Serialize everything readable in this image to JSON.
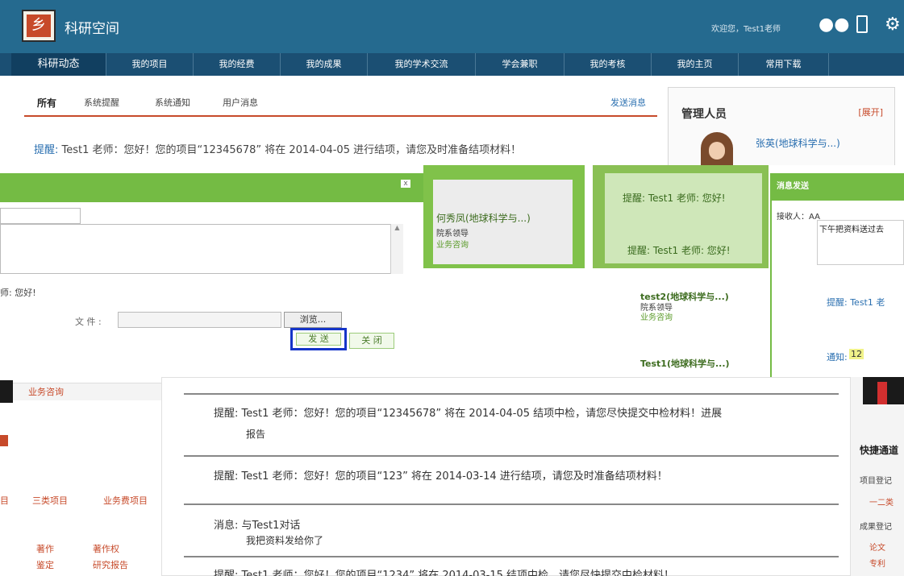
{
  "app": {
    "logo_text": "乡",
    "title": "科研空间",
    "welcome": "欢迎您，Test1老师"
  },
  "nav": [
    "科研动态",
    "我的项目",
    "我的经费",
    "我的成果",
    "我的学术交流",
    "学会兼职",
    "我的考核",
    "我的主页",
    "常用下载"
  ],
  "tabs": {
    "items": [
      "所有",
      "系统提醒",
      "系统通知",
      "用户消息"
    ],
    "send_link": "发送消息"
  },
  "reminder": {
    "tag": "提醒:",
    "text": " Test1 老师：您好！您的项目“12345678” 将在 2014-04-05 进行结项，请您及时准备结项材料！"
  },
  "admin_panel": {
    "title": "管理人员",
    "expand": "[展开]",
    "name": "张英(地球科学与...)"
  },
  "modal": {
    "close": "x",
    "file_label": "文 件 :",
    "browse": "浏览...",
    "send": "发 送",
    "close_btn": "关 闭",
    "reminder_tail": "师: 您好!"
  },
  "contacts": [
    {
      "name": "何秀凤(地球科学与...)",
      "role": "院系领导",
      "action": "业务咨询"
    }
  ],
  "bg_reminders": [
    "提醒: Test1 老师: 您好!",
    "提醒: Test1 老师: 您好!"
  ],
  "message_send": {
    "title": "消息发送",
    "recipient_label": "接收人：AA",
    "content": "下午把资料送过去"
  },
  "students": [
    {
      "name": "test2(地球科学与...)",
      "role": "院系领导",
      "action": "业务咨询"
    },
    {
      "name": "Test1(地球科学与...)"
    }
  ],
  "right_reminder": "提醒: Test1 老",
  "right_notice": "通知:",
  "right_count": "12",
  "left_panel": {
    "biz": "业务咨询",
    "sub_nav": [
      "目",
      "三类项目",
      "业务费项目"
    ],
    "works": [
      "著作",
      "著作权",
      "鉴定",
      "研究报告"
    ]
  },
  "messages": [
    {
      "text": "提醒: Test1 老师：您好！您的项目“12345678” 将在 2014-04-05 结项中检，请您尽快提交中检材料！进展",
      "sub": "报告"
    },
    {
      "text": "提醒: Test1 老师：您好！您的项目“123” 将在 2014-03-14 进行结项，请您及时准备结项材料！"
    },
    {
      "text": "消息: 与Test1对话",
      "sub": "我把资料发给你了"
    },
    {
      "text": "提醒: Test1 老师：您好！您的项目“1234” 将在 2014-03-15 结项中检，请您尽快提交中检材料！"
    }
  ],
  "quick": {
    "title": "快捷通道",
    "items": [
      "项目登记",
      "一二类",
      "成果登记",
      "论文",
      "专利"
    ]
  },
  "colors": {
    "header": "#256a8f",
    "nav": "#1b4f73",
    "accent": "#c74a2a",
    "green": "#74bb44",
    "link": "#2a6fb0"
  }
}
